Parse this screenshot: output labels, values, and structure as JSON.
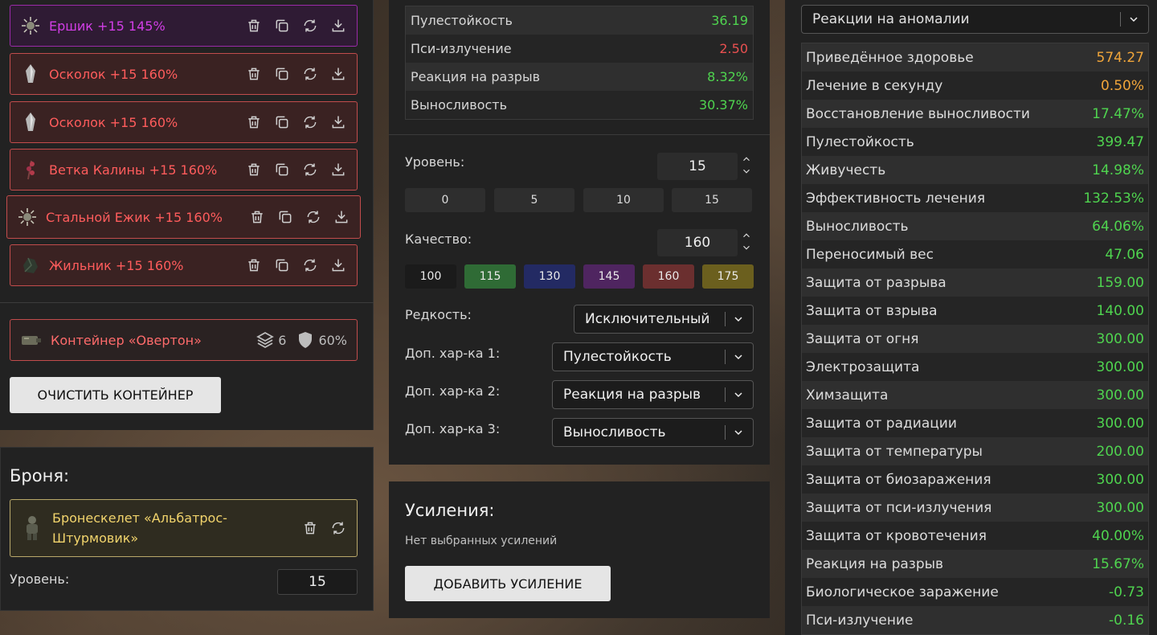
{
  "artifacts": [
    {
      "name": "Ершик +15 145%",
      "color": "purple",
      "icon": "spiky-ball-icon"
    },
    {
      "name": "Осколок +15 160%",
      "color": "red",
      "icon": "shard-icon"
    },
    {
      "name": "Осколок +15 160%",
      "color": "red",
      "icon": "shard-icon"
    },
    {
      "name": "Ветка Калины +15 160%",
      "color": "red",
      "icon": "branch-icon"
    },
    {
      "name": "Стальной Ежик +15 160%",
      "color": "red",
      "icon": "spiky-ball-icon"
    },
    {
      "name": "Жильник +15 160%",
      "color": "red",
      "icon": "rock-icon"
    }
  ],
  "container": {
    "name": "Контейнер «Овертон»",
    "slots": "6",
    "protection": "60%"
  },
  "clear_container_label": "ОЧИСТИТЬ КОНТЕЙНЕР",
  "armor": {
    "title": "Броня:",
    "name": "Бронескелет «Альбатрос-Штурмовик»",
    "level_label": "Уровень:",
    "level_value": "15"
  },
  "artifact_stats": [
    {
      "label": "Пулестойкость",
      "value": "36.19",
      "color": "green"
    },
    {
      "label": "Пси-излучение",
      "value": "2.50",
      "color": "red"
    },
    {
      "label": "Реакция на разрыв",
      "value": "8.32%",
      "color": "green"
    },
    {
      "label": "Выносливость",
      "value": "30.37%",
      "color": "green"
    }
  ],
  "editor": {
    "level_label": "Уровень:",
    "level_value": "15",
    "level_presets": [
      "0",
      "5",
      "10",
      "15"
    ],
    "quality_label": "Качество:",
    "quality_value": "160",
    "quality_presets": [
      {
        "label": "100",
        "color": "#1b1b1b"
      },
      {
        "label": "115",
        "color": "#2f6b35"
      },
      {
        "label": "130",
        "color": "#232a63"
      },
      {
        "label": "145",
        "color": "#4f2560"
      },
      {
        "label": "160",
        "color": "#6b2f2f"
      },
      {
        "label": "175",
        "color": "#6b5f1e"
      }
    ],
    "rarity_label": "Редкость:",
    "rarity_value": "Исключительный",
    "extra1_label": "Доп. хар-ка 1:",
    "extra1_value": "Пулестойкость",
    "extra2_label": "Доп. хар-ка 2:",
    "extra2_value": "Реакция на разрыв",
    "extra3_label": "Доп. хар-ка 3:",
    "extra3_value": "Выносливость"
  },
  "boosts": {
    "title": "Усиления:",
    "empty_text": "Нет выбранных усилений",
    "add_label": "ДОБАВИТЬ УСИЛЕНИЕ"
  },
  "summary": {
    "select_value": "Реакции на аномалии",
    "rows": [
      {
        "label": "Приведённое здоровье",
        "value": "574.27",
        "color": "orange"
      },
      {
        "label": "Лечение в секунду",
        "value": "0.50%",
        "color": "orange"
      },
      {
        "label": "Восстановление выносливости",
        "value": "17.47%",
        "color": "green"
      },
      {
        "label": "Пулестойкость",
        "value": "399.47",
        "color": "green"
      },
      {
        "label": "Живучесть",
        "value": "14.98%",
        "color": "green"
      },
      {
        "label": "Эффективность лечения",
        "value": "132.53%",
        "color": "green"
      },
      {
        "label": "Выносливость",
        "value": "64.06%",
        "color": "green"
      },
      {
        "label": "Переносимый вес",
        "value": "47.06",
        "color": "green"
      },
      {
        "label": "Защита от разрыва",
        "value": "159.00",
        "color": "green"
      },
      {
        "label": "Защита от взрыва",
        "value": "140.00",
        "color": "green"
      },
      {
        "label": "Защита от огня",
        "value": "300.00",
        "color": "green"
      },
      {
        "label": "Электрозащита",
        "value": "300.00",
        "color": "green"
      },
      {
        "label": "Химзащита",
        "value": "300.00",
        "color": "green"
      },
      {
        "label": "Защита от радиации",
        "value": "300.00",
        "color": "green"
      },
      {
        "label": "Защита от температуры",
        "value": "200.00",
        "color": "green"
      },
      {
        "label": "Защита от биозаражения",
        "value": "300.00",
        "color": "green"
      },
      {
        "label": "Защита от пси-излучения",
        "value": "300.00",
        "color": "green"
      },
      {
        "label": "Защита от кровотечения",
        "value": "40.00%",
        "color": "green"
      },
      {
        "label": "Реакция на разрыв",
        "value": "15.67%",
        "color": "green"
      },
      {
        "label": "Биологическое заражение",
        "value": "-0.73",
        "color": "green"
      },
      {
        "label": "Пси-излучение",
        "value": "-0.16",
        "color": "green"
      }
    ]
  }
}
